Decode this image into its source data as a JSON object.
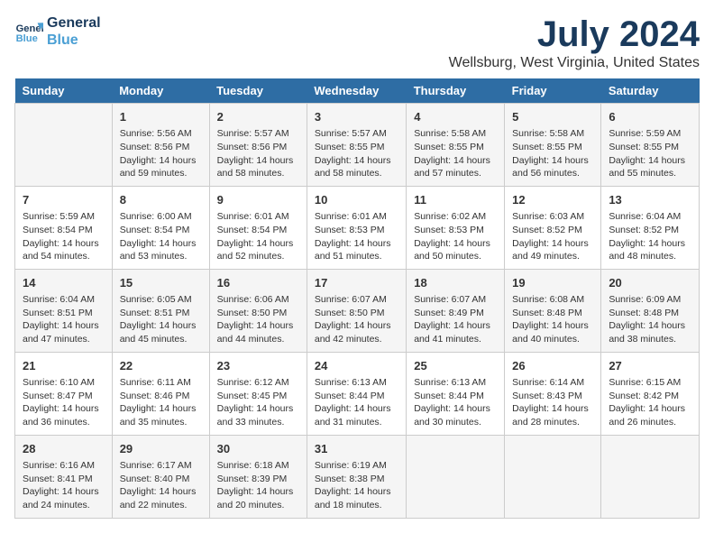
{
  "header": {
    "logo_line1": "General",
    "logo_line2": "Blue",
    "title": "July 2024",
    "subtitle": "Wellsburg, West Virginia, United States"
  },
  "days_of_week": [
    "Sunday",
    "Monday",
    "Tuesday",
    "Wednesday",
    "Thursday",
    "Friday",
    "Saturday"
  ],
  "weeks": [
    [
      {
        "day": "",
        "info": ""
      },
      {
        "day": "1",
        "info": "Sunrise: 5:56 AM\nSunset: 8:56 PM\nDaylight: 14 hours\nand 59 minutes."
      },
      {
        "day": "2",
        "info": "Sunrise: 5:57 AM\nSunset: 8:56 PM\nDaylight: 14 hours\nand 58 minutes."
      },
      {
        "day": "3",
        "info": "Sunrise: 5:57 AM\nSunset: 8:55 PM\nDaylight: 14 hours\nand 58 minutes."
      },
      {
        "day": "4",
        "info": "Sunrise: 5:58 AM\nSunset: 8:55 PM\nDaylight: 14 hours\nand 57 minutes."
      },
      {
        "day": "5",
        "info": "Sunrise: 5:58 AM\nSunset: 8:55 PM\nDaylight: 14 hours\nand 56 minutes."
      },
      {
        "day": "6",
        "info": "Sunrise: 5:59 AM\nSunset: 8:55 PM\nDaylight: 14 hours\nand 55 minutes."
      }
    ],
    [
      {
        "day": "7",
        "info": "Sunrise: 5:59 AM\nSunset: 8:54 PM\nDaylight: 14 hours\nand 54 minutes."
      },
      {
        "day": "8",
        "info": "Sunrise: 6:00 AM\nSunset: 8:54 PM\nDaylight: 14 hours\nand 53 minutes."
      },
      {
        "day": "9",
        "info": "Sunrise: 6:01 AM\nSunset: 8:54 PM\nDaylight: 14 hours\nand 52 minutes."
      },
      {
        "day": "10",
        "info": "Sunrise: 6:01 AM\nSunset: 8:53 PM\nDaylight: 14 hours\nand 51 minutes."
      },
      {
        "day": "11",
        "info": "Sunrise: 6:02 AM\nSunset: 8:53 PM\nDaylight: 14 hours\nand 50 minutes."
      },
      {
        "day": "12",
        "info": "Sunrise: 6:03 AM\nSunset: 8:52 PM\nDaylight: 14 hours\nand 49 minutes."
      },
      {
        "day": "13",
        "info": "Sunrise: 6:04 AM\nSunset: 8:52 PM\nDaylight: 14 hours\nand 48 minutes."
      }
    ],
    [
      {
        "day": "14",
        "info": "Sunrise: 6:04 AM\nSunset: 8:51 PM\nDaylight: 14 hours\nand 47 minutes."
      },
      {
        "day": "15",
        "info": "Sunrise: 6:05 AM\nSunset: 8:51 PM\nDaylight: 14 hours\nand 45 minutes."
      },
      {
        "day": "16",
        "info": "Sunrise: 6:06 AM\nSunset: 8:50 PM\nDaylight: 14 hours\nand 44 minutes."
      },
      {
        "day": "17",
        "info": "Sunrise: 6:07 AM\nSunset: 8:50 PM\nDaylight: 14 hours\nand 42 minutes."
      },
      {
        "day": "18",
        "info": "Sunrise: 6:07 AM\nSunset: 8:49 PM\nDaylight: 14 hours\nand 41 minutes."
      },
      {
        "day": "19",
        "info": "Sunrise: 6:08 AM\nSunset: 8:48 PM\nDaylight: 14 hours\nand 40 minutes."
      },
      {
        "day": "20",
        "info": "Sunrise: 6:09 AM\nSunset: 8:48 PM\nDaylight: 14 hours\nand 38 minutes."
      }
    ],
    [
      {
        "day": "21",
        "info": "Sunrise: 6:10 AM\nSunset: 8:47 PM\nDaylight: 14 hours\nand 36 minutes."
      },
      {
        "day": "22",
        "info": "Sunrise: 6:11 AM\nSunset: 8:46 PM\nDaylight: 14 hours\nand 35 minutes."
      },
      {
        "day": "23",
        "info": "Sunrise: 6:12 AM\nSunset: 8:45 PM\nDaylight: 14 hours\nand 33 minutes."
      },
      {
        "day": "24",
        "info": "Sunrise: 6:13 AM\nSunset: 8:44 PM\nDaylight: 14 hours\nand 31 minutes."
      },
      {
        "day": "25",
        "info": "Sunrise: 6:13 AM\nSunset: 8:44 PM\nDaylight: 14 hours\nand 30 minutes."
      },
      {
        "day": "26",
        "info": "Sunrise: 6:14 AM\nSunset: 8:43 PM\nDaylight: 14 hours\nand 28 minutes."
      },
      {
        "day": "27",
        "info": "Sunrise: 6:15 AM\nSunset: 8:42 PM\nDaylight: 14 hours\nand 26 minutes."
      }
    ],
    [
      {
        "day": "28",
        "info": "Sunrise: 6:16 AM\nSunset: 8:41 PM\nDaylight: 14 hours\nand 24 minutes."
      },
      {
        "day": "29",
        "info": "Sunrise: 6:17 AM\nSunset: 8:40 PM\nDaylight: 14 hours\nand 22 minutes."
      },
      {
        "day": "30",
        "info": "Sunrise: 6:18 AM\nSunset: 8:39 PM\nDaylight: 14 hours\nand 20 minutes."
      },
      {
        "day": "31",
        "info": "Sunrise: 6:19 AM\nSunset: 8:38 PM\nDaylight: 14 hours\nand 18 minutes."
      },
      {
        "day": "",
        "info": ""
      },
      {
        "day": "",
        "info": ""
      },
      {
        "day": "",
        "info": ""
      }
    ]
  ]
}
